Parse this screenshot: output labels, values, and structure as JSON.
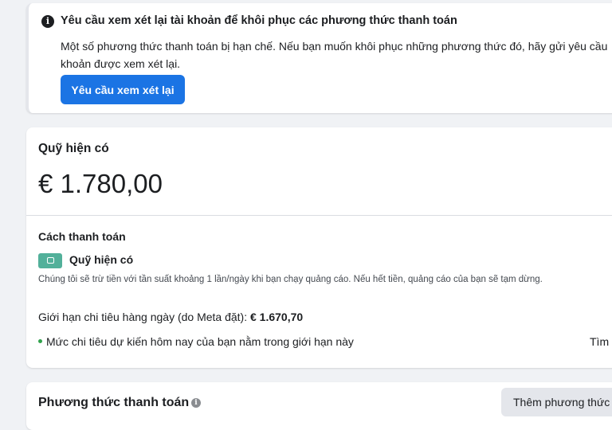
{
  "alert": {
    "icon": "info-icon",
    "title": "Yêu cầu xem xét lại tài khoản để khôi phục các phương thức thanh toán",
    "body": "Một số phương thức thanh toán bị hạn chế. Nếu bạn muốn khôi phục những phương thức đó, hãy gửi yêu cầu khoản được xem xét lại.",
    "button_label": "Yêu cầu xem xét lại"
  },
  "funds": {
    "title": "Quỹ hiện có",
    "amount": "€ 1.780,00",
    "payment_method_heading": "Cách thanh toán",
    "method_icon": "wallet-icon",
    "method_label": "Quỹ hiện có",
    "description": "Chúng tôi sẽ trừ tiền với tần suất khoảng 1 lần/ngày khi bạn chạy quảng cáo. Nếu hết tiền, quảng cáo của bạn sẽ tạm dừng.",
    "daily_limit_label": "Giới hạn chi tiêu hàng ngày (do Meta đặt): ",
    "daily_limit_value": "€ 1.670,70",
    "status_text": "Mức chi tiêu dự kiến hôm nay của bạn nằm trong giới hạn này",
    "find_link": "Tìm"
  },
  "methods": {
    "title": "Phương thức thanh toán",
    "info_icon": "info-icon",
    "add_button_label": "Thêm phương thức"
  },
  "colors": {
    "primary_button": "#1b74e4",
    "wallet_icon": "#52b09a",
    "status_dot": "#31a24c",
    "background": "#f0f2f5"
  }
}
